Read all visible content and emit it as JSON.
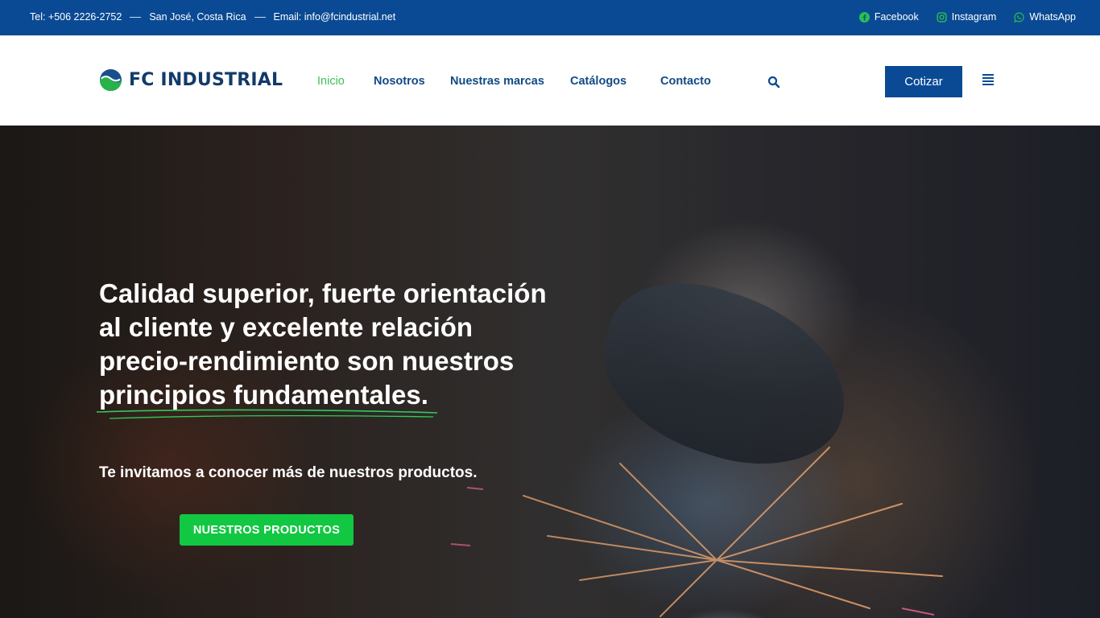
{
  "topbar": {
    "phone": "Tel: +506 2226-2752",
    "location": "San José, Costa Rica",
    "email": "Email: info@fcindustrial.net",
    "social": [
      {
        "label": "Facebook",
        "icon": "facebook-icon"
      },
      {
        "label": "Instagram",
        "icon": "instagram-icon"
      },
      {
        "label": "WhatsApp",
        "icon": "whatsapp-icon"
      }
    ]
  },
  "header": {
    "logo_text": "FC INDUSTRIAL",
    "nav": [
      {
        "label": "Inicio",
        "active": true
      },
      {
        "label": "Nosotros",
        "active": false
      },
      {
        "label": "Nuestras marcas",
        "active": false
      },
      {
        "label": "Catálogos",
        "active": false
      },
      {
        "label": "Contacto",
        "active": false
      }
    ],
    "cta_label": "Cotizar"
  },
  "hero": {
    "headline": "Calidad superior, fuerte orientación al cliente y excelente relación precio-rendimiento son nuestros principios fundamentales.",
    "subtext": "Te invitamos a conocer más de nuestros productos.",
    "button_label": "NUESTROS PRODUCTOS"
  },
  "colors": {
    "brand_blue": "#0a4a94",
    "nav_blue": "#114a86",
    "active_green": "#3fbf5a",
    "cta_green": "#12c742"
  }
}
